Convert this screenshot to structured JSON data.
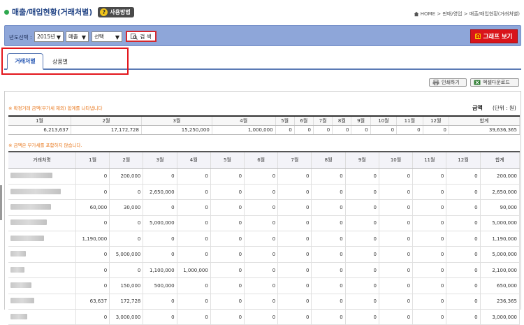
{
  "header": {
    "title": "매출/매입현황(거래처별)",
    "help_label": "사용방법",
    "breadcrumb": "HOME > 판매/영업 > 매출/매입현황(거래처별)"
  },
  "filter": {
    "label": "년도선택 :",
    "year": "2015년",
    "type": "매출",
    "select": "선택",
    "search_label": "검 색",
    "graph_label": "그래프 보기",
    "graph_icon_text": "Ω"
  },
  "tabs": [
    {
      "label": "거래처별",
      "active": true
    },
    {
      "label": "상품별",
      "active": false
    }
  ],
  "buttons": {
    "print": "인쇄하기",
    "excel": "엑셀다운로드"
  },
  "summary": {
    "note": "※ 확정거래 금액(부가세 제외) 합계를 나타냅니다",
    "amount_label": "금액",
    "unit_label": "(단위 : 원)",
    "headers": [
      "1월",
      "2월",
      "3월",
      "4월",
      "5월",
      "6월",
      "7월",
      "8월",
      "9월",
      "10월",
      "11월",
      "12월",
      "합계"
    ],
    "values": [
      "6,213,637",
      "17,172,728",
      "15,250,000",
      "1,000,000",
      "0",
      "0",
      "0",
      "0",
      "0",
      "0",
      "0",
      "0",
      "39,636,365"
    ]
  },
  "detail": {
    "note": "※ 금액은 부가세를 포함하지 않습니다.",
    "headers": [
      "거래처명",
      "1월",
      "2월",
      "3월",
      "4월",
      "5월",
      "6월",
      "7월",
      "8월",
      "9월",
      "10월",
      "11월",
      "12월",
      "합계"
    ],
    "rows": [
      {
        "name_blur_width": 60,
        "values": [
          "0",
          "200,000",
          "0",
          "0",
          "0",
          "0",
          "0",
          "0",
          "0",
          "0",
          "0",
          "0",
          "200,000"
        ]
      },
      {
        "name_blur_width": 72,
        "values": [
          "0",
          "0",
          "2,650,000",
          "0",
          "0",
          "0",
          "0",
          "0",
          "0",
          "0",
          "0",
          "0",
          "2,650,000"
        ]
      },
      {
        "name_blur_width": 58,
        "values": [
          "60,000",
          "30,000",
          "0",
          "0",
          "0",
          "0",
          "0",
          "0",
          "0",
          "0",
          "0",
          "0",
          "90,000"
        ]
      },
      {
        "name_blur_width": 52,
        "values": [
          "0",
          "0",
          "5,000,000",
          "0",
          "0",
          "0",
          "0",
          "0",
          "0",
          "0",
          "0",
          "0",
          "5,000,000"
        ]
      },
      {
        "name_blur_width": 48,
        "values": [
          "1,190,000",
          "0",
          "0",
          "0",
          "0",
          "0",
          "0",
          "0",
          "0",
          "0",
          "0",
          "0",
          "1,190,000"
        ]
      },
      {
        "name_blur_width": 22,
        "values": [
          "0",
          "5,000,000",
          "0",
          "0",
          "0",
          "0",
          "0",
          "0",
          "0",
          "0",
          "0",
          "0",
          "5,000,000"
        ]
      },
      {
        "name_blur_width": 20,
        "values": [
          "0",
          "0",
          "1,100,000",
          "1,000,000",
          "0",
          "0",
          "0",
          "0",
          "0",
          "0",
          "0",
          "0",
          "2,100,000"
        ]
      },
      {
        "name_blur_width": 30,
        "values": [
          "0",
          "150,000",
          "500,000",
          "0",
          "0",
          "0",
          "0",
          "0",
          "0",
          "0",
          "0",
          "0",
          "650,000"
        ]
      },
      {
        "name_blur_width": 34,
        "values": [
          "63,637",
          "172,728",
          "0",
          "0",
          "0",
          "0",
          "0",
          "0",
          "0",
          "0",
          "0",
          "0",
          "236,365"
        ]
      },
      {
        "name_blur_width": 24,
        "values": [
          "0",
          "3,000,000",
          "0",
          "0",
          "0",
          "0",
          "0",
          "0",
          "0",
          "0",
          "0",
          "0",
          "3,000,000"
        ]
      }
    ]
  },
  "colors": {
    "accent": "#2a5ab5",
    "filter_bar": "#8ea6d9",
    "highlight_box": "#e3161c",
    "graph_button": "#d9141a",
    "note": "#e8761a"
  }
}
